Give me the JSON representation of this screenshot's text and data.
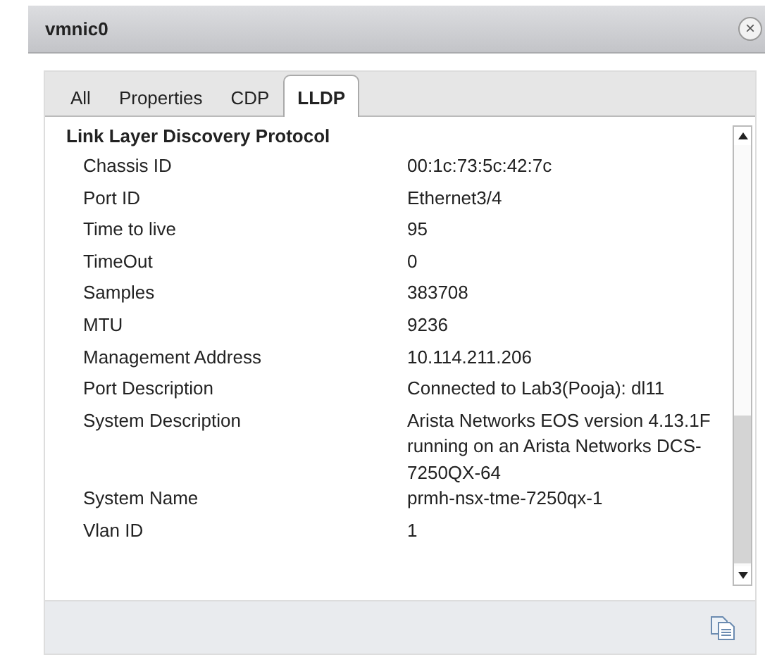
{
  "window": {
    "title": "vmnic0",
    "close": "×"
  },
  "tabs": [
    {
      "label": "All",
      "selected": false
    },
    {
      "label": "Properties",
      "selected": false
    },
    {
      "label": "CDP",
      "selected": false
    },
    {
      "label": "LLDP",
      "selected": true
    }
  ],
  "section": {
    "title": "Link Layer Discovery Protocol"
  },
  "rows": [
    {
      "label": "Chassis ID",
      "value": "00:1c:73:5c:42:7c"
    },
    {
      "label": "Port ID",
      "value": "Ethernet3/4"
    },
    {
      "label": "Time to live",
      "value": "95"
    },
    {
      "label": "TimeOut",
      "value": "0"
    },
    {
      "label": "Samples",
      "value": "383708"
    },
    {
      "label": "MTU",
      "value": "9236"
    },
    {
      "label": "Management Address",
      "value": "10.114.211.206"
    },
    {
      "label": "Port Description",
      "value": "Connected to Lab3(Pooja): dl11"
    },
    {
      "label": "System Description",
      "value": "Arista Networks EOS version 4.13.1F running on an Arista Networks DCS-7250QX-64"
    },
    {
      "label": "System Name",
      "value": "prmh-nsx-tme-7250qx-1"
    },
    {
      "label": "Vlan ID",
      "value": "1"
    }
  ]
}
